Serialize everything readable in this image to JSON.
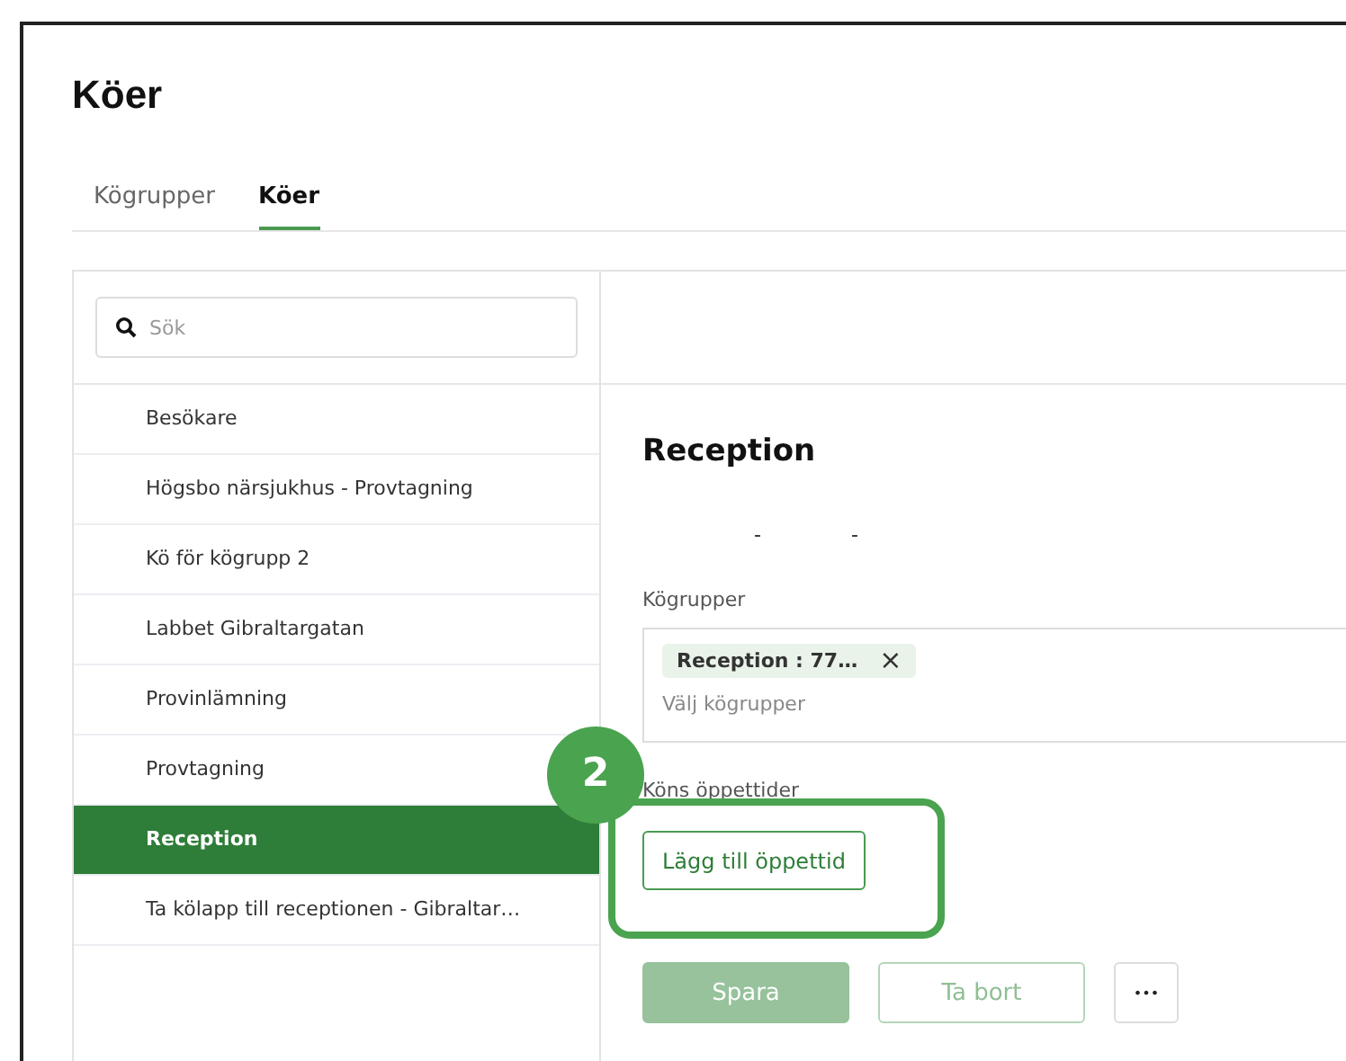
{
  "page": {
    "title": "Köer"
  },
  "tabs": [
    {
      "label": "Kögrupper",
      "selected": false
    },
    {
      "label": "Köer",
      "selected": true
    }
  ],
  "search": {
    "placeholder": "Sök"
  },
  "queues": [
    {
      "label": "Besökare",
      "selected": false
    },
    {
      "label": "Högsbo närsjukhus - Provtagning",
      "selected": false
    },
    {
      "label": "Kö för kögrupp 2",
      "selected": false
    },
    {
      "label": "Labbet Gibraltargatan",
      "selected": false
    },
    {
      "label": "Provinlämning",
      "selected": false
    },
    {
      "label": "Provtagning",
      "selected": false
    },
    {
      "label": "Reception",
      "selected": true
    },
    {
      "label": "Ta kölapp till receptionen - Gibraltar…",
      "selected": false
    }
  ],
  "detail": {
    "title": "Reception",
    "dashes": [
      "-",
      "-"
    ],
    "groups_label": "Kögrupper",
    "groups_tags": [
      "Reception : 77…"
    ],
    "groups_remove": "×",
    "groups_placeholder": "Välj kögrupper",
    "hours_label": "Köns öppettider",
    "add_hours_button": "Lägg till öppettid",
    "actions": [
      {
        "kind": "primary",
        "label": "Spara",
        "disabled": true
      },
      {
        "kind": "outline",
        "label": "Ta bort",
        "disabled": true
      },
      {
        "kind": "more",
        "label": "•••",
        "disabled": false
      }
    ]
  },
  "annotation": {
    "number": "2"
  }
}
